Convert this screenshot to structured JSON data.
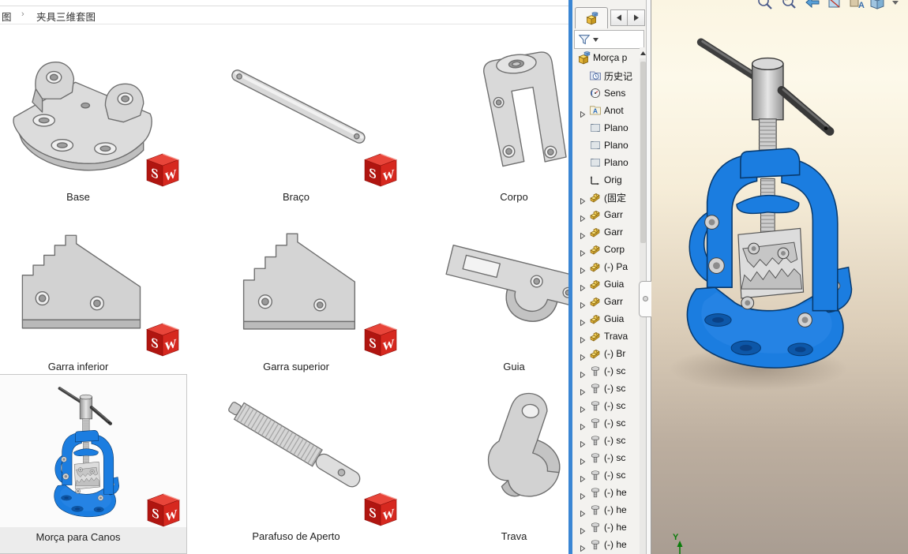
{
  "explorer": {
    "breadcrumb": {
      "root": "图",
      "separator": "›",
      "current": "夹具三维套图"
    },
    "tiles": [
      {
        "label": "Base",
        "art": "base",
        "selected": false
      },
      {
        "label": "Braço",
        "art": "braco",
        "selected": false
      },
      {
        "label": "Corpo",
        "art": "corpo",
        "selected": false
      },
      {
        "label": "Garra inferior",
        "art": "garra-inf",
        "selected": false
      },
      {
        "label": "Garra superior",
        "art": "garra-sup",
        "selected": false
      },
      {
        "label": "Guia",
        "art": "guia",
        "selected": false
      },
      {
        "label": "Morça para Canos",
        "art": "vise",
        "selected": true
      },
      {
        "label": "Parafuso de Aperto",
        "art": "parafuso",
        "selected": false
      },
      {
        "label": "Trava",
        "art": "trava",
        "selected": false
      }
    ]
  },
  "sw_badge": {
    "letters": "SW",
    "red": "#d6281f"
  },
  "solidworks": {
    "feature_tree": {
      "root": "Morça p",
      "items": [
        {
          "label": "历史记",
          "icon": "history-folder-icon",
          "expandable": false
        },
        {
          "label": "Sens",
          "icon": "sensors-icon",
          "expandable": false
        },
        {
          "label": "Anot",
          "icon": "annotations-folder-icon",
          "expandable": true
        },
        {
          "label": "Plano",
          "icon": "plane-icon",
          "expandable": false
        },
        {
          "label": "Plano",
          "icon": "plane-icon",
          "expandable": false
        },
        {
          "label": "Plano",
          "icon": "plane-icon",
          "expandable": false
        },
        {
          "label": "Orig",
          "icon": "origin-icon",
          "expandable": false
        },
        {
          "label": "(固定",
          "icon": "part-icon",
          "expandable": true
        },
        {
          "label": "Garr",
          "icon": "part-icon",
          "expandable": true
        },
        {
          "label": "Garr",
          "icon": "part-icon",
          "expandable": true
        },
        {
          "label": "Corp",
          "icon": "part-icon",
          "expandable": true
        },
        {
          "label": "(-) Pa",
          "icon": "part-icon",
          "expandable": true
        },
        {
          "label": "Guia",
          "icon": "part-icon",
          "expandable": true
        },
        {
          "label": "Garr",
          "icon": "part-icon",
          "expandable": true
        },
        {
          "label": "Guia",
          "icon": "part-icon",
          "expandable": true
        },
        {
          "label": "Trava",
          "icon": "part-icon",
          "expandable": true
        },
        {
          "label": "(-) Br",
          "icon": "part-icon",
          "expandable": true
        },
        {
          "label": "(-) sc",
          "icon": "screw-icon",
          "expandable": true
        },
        {
          "label": "(-) sc",
          "icon": "screw-icon",
          "expandable": true
        },
        {
          "label": "(-) sc",
          "icon": "screw-icon",
          "expandable": true
        },
        {
          "label": "(-) sc",
          "icon": "screw-icon",
          "expandable": true
        },
        {
          "label": "(-) sc",
          "icon": "screw-icon",
          "expandable": true
        },
        {
          "label": "(-) sc",
          "icon": "screw-icon",
          "expandable": true
        },
        {
          "label": "(-) sc",
          "icon": "screw-icon",
          "expandable": true
        },
        {
          "label": "(-) he",
          "icon": "screw-icon",
          "expandable": true
        },
        {
          "label": "(-) he",
          "icon": "screw-icon",
          "expandable": true
        },
        {
          "label": "(-) he",
          "icon": "screw-icon",
          "expandable": true
        },
        {
          "label": "(-) he",
          "icon": "screw-icon",
          "expandable": true
        }
      ]
    },
    "viewport": {
      "triad_y_label": "Y",
      "toolbar_icons": [
        "zoom-fit-icon",
        "zoom-area-icon",
        "previous-view-icon",
        "section-view-icon",
        "annotation-view-icon",
        "display-style-icon",
        "dropdown-caret-icon"
      ],
      "colors": {
        "model_blue": "#1b7de0",
        "bg_top": "#fbf5e2",
        "bg_bottom": "#a99d92",
        "window_border": "#3a86d4"
      }
    }
  }
}
